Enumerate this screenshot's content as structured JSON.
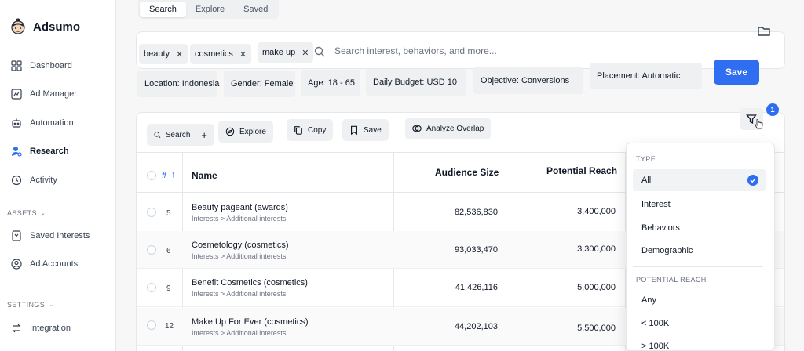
{
  "app": {
    "name": "Adsumo"
  },
  "sidebar": {
    "items": [
      {
        "label": "Dashboard",
        "icon": "dashboard-icon"
      },
      {
        "label": "Ad Manager",
        "icon": "ad-manager-icon"
      },
      {
        "label": "Automation",
        "icon": "robot-icon"
      },
      {
        "label": "Research",
        "icon": "research-icon",
        "active": true
      },
      {
        "label": "Activity",
        "icon": "history-icon"
      }
    ],
    "assets_label": "ASSETS",
    "assets_items": [
      {
        "label": "Saved Interests",
        "icon": "saved-icon"
      },
      {
        "label": "Ad Accounts",
        "icon": "account-icon"
      }
    ],
    "settings_label": "SETTINGS",
    "settings_items": [
      {
        "label": "Integration",
        "icon": "integration-icon"
      }
    ]
  },
  "tabs": [
    "Search",
    "Explore",
    "Saved"
  ],
  "search": {
    "chips": [
      "beauty",
      "cosmetics",
      "make up"
    ],
    "placeholder": "Search interest, behaviors, and more..."
  },
  "filters": {
    "location": "Location: Indonesia",
    "gender": "Gender: Female",
    "age": "Age: 18 - 65",
    "budget": "Daily Budget: USD 10",
    "objective": "Objective: Conversions",
    "placement": "Placement: Automatic",
    "save_label": "Save"
  },
  "toolbar": {
    "search": "Search",
    "plus": "+",
    "explore": "Explore",
    "copy": "Copy",
    "save": "Save",
    "analyze": "Analyze Overlap",
    "filter_badge": "1"
  },
  "table": {
    "headers": {
      "num": "#",
      "sort": "↑",
      "name": "Name",
      "audience": "Audience Size",
      "reach": "Potential Reach"
    },
    "rows": [
      {
        "num": "5",
        "name": "Beauty pageant (awards)",
        "path": "Interests > Additional interests",
        "audience": "82,536,830",
        "reach": "3,400,000"
      },
      {
        "num": "6",
        "name": "Cosmetology (cosmetics)",
        "path": "Interests > Additional interests",
        "audience": "93,033,470",
        "reach": "3,300,000"
      },
      {
        "num": "9",
        "name": "Benefit Cosmetics (cosmetics)",
        "path": "Interests > Additional interests",
        "audience": "41,426,116",
        "reach": "5,000,000"
      },
      {
        "num": "12",
        "name": "Make Up For Ever (cosmetics)",
        "path": "Interests > Additional interests",
        "audience": "44,202,103",
        "reach": "5,500,000"
      }
    ]
  },
  "dropdown": {
    "type_label": "TYPE",
    "type_options": [
      "All",
      "Interest",
      "Behaviors",
      "Demographic"
    ],
    "reach_label": "POTENTIAL REACH",
    "reach_options": [
      "Any",
      "< 100K",
      "> 100K"
    ]
  },
  "colors": {
    "accent": "#2f6ef0"
  }
}
